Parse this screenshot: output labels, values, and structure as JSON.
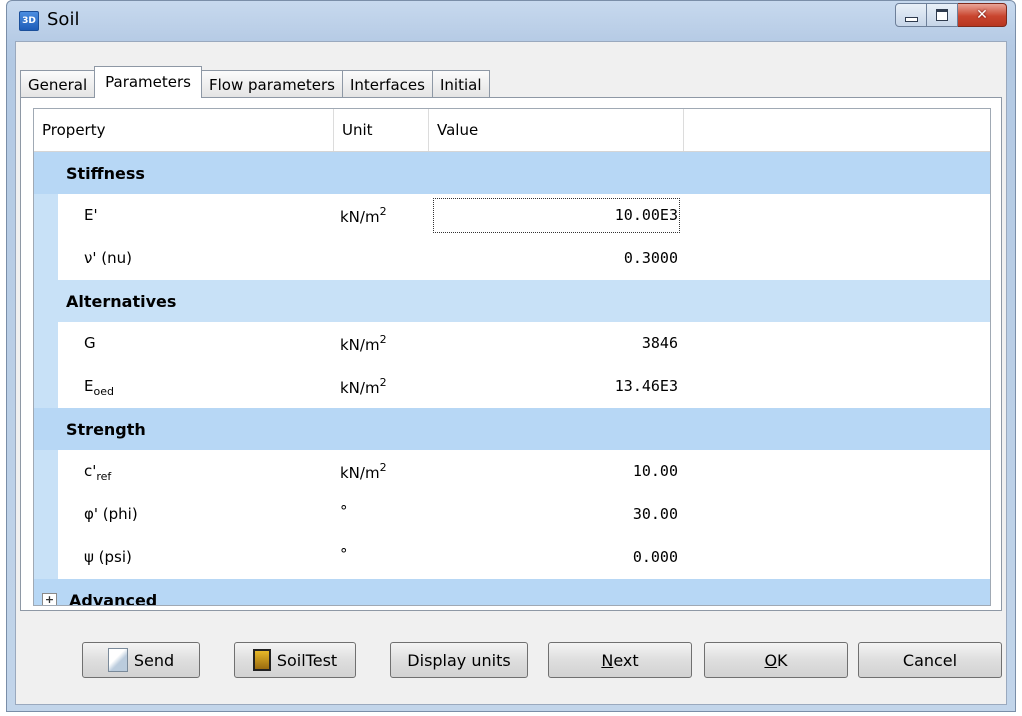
{
  "window": {
    "title": "Soil",
    "app_icon": "3D"
  },
  "tabs": [
    "General",
    "Parameters",
    "Flow parameters",
    "Interfaces",
    "Initial"
  ],
  "active_tab": "Parameters",
  "grid": {
    "headers": {
      "property": "Property",
      "unit": "Unit",
      "value": "Value"
    },
    "groups": [
      {
        "label": "Stiffness",
        "rows": [
          {
            "prop": "E'",
            "prop_sub": "",
            "unit": "kN/m",
            "unit_sup": "2",
            "value": "10.00E3"
          },
          {
            "prop": "ν' (nu)",
            "prop_sub": "",
            "unit": "",
            "unit_sup": "",
            "value": "0.3000"
          }
        ]
      },
      {
        "label": "Alternatives",
        "rows": [
          {
            "prop": "G",
            "prop_sub": "",
            "unit": "kN/m",
            "unit_sup": "2",
            "value": "3846"
          },
          {
            "prop": "E",
            "prop_sub": "oed",
            "unit": "kN/m",
            "unit_sup": "2",
            "value": "13.46E3"
          }
        ]
      },
      {
        "label": "Strength",
        "rows": [
          {
            "prop": "c'",
            "prop_sub": "ref",
            "unit": "kN/m",
            "unit_sup": "2",
            "value": "10.00"
          },
          {
            "prop": "φ' (phi)",
            "prop_sub": "",
            "unit": "°",
            "unit_sup": "",
            "value": "30.00"
          },
          {
            "prop": "ψ (psi)",
            "prop_sub": "",
            "unit": "°",
            "unit_sup": "",
            "value": "0.000"
          }
        ]
      }
    ],
    "advanced": {
      "label": "Advanced",
      "expander": "+"
    }
  },
  "buttons": {
    "send": "Send",
    "soiltest": "SoilTest",
    "display_units": "Display units",
    "next_pre": "",
    "next_u": "N",
    "next_post": "ext",
    "ok_u": "O",
    "ok_post": "K",
    "cancel": "Cancel"
  },
  "colors": {
    "group_bg": "#b7d7f5",
    "indent_bg": "#c8e1f7",
    "close_red": "#c9452f"
  }
}
